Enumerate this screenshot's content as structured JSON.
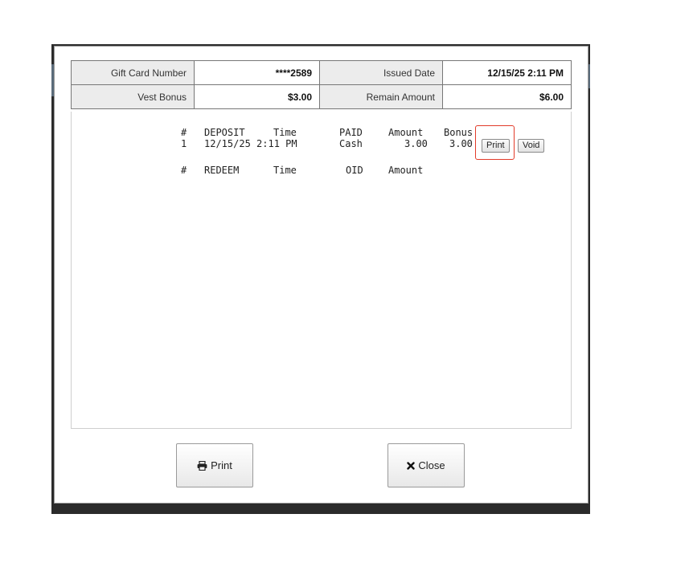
{
  "info": {
    "gift_card_label": "Gift Card Number",
    "gift_card_value": "****2589",
    "issued_date_label": "Issued Date",
    "issued_date_value": "12/15/25 2:11 PM",
    "vest_bonus_label": "Vest Bonus",
    "vest_bonus_value": "$3.00",
    "remain_amount_label": "Remain Amount",
    "remain_amount_value": "$6.00"
  },
  "deposit": {
    "header": {
      "num": "#",
      "type": "DEPOSIT",
      "time": "Time",
      "paid": "PAID",
      "amount": "Amount",
      "bonus": "Bonus"
    },
    "rows": [
      {
        "num": "1",
        "time": "12/15/25 2:11 PM",
        "paid": "Cash",
        "amount": "3.00",
        "bonus": "3.00",
        "print_label": "Print",
        "void_label": "Void"
      }
    ]
  },
  "redeem": {
    "header": {
      "num": "#",
      "type": "REDEEM",
      "time": "Time",
      "oid": "OID",
      "amount": "Amount"
    }
  },
  "footer": {
    "print_label": "Print",
    "close_label": "Close"
  },
  "icons": {
    "print": "printer-icon",
    "close": "close-x-icon"
  },
  "colors": {
    "highlight": "#e23b2a"
  }
}
